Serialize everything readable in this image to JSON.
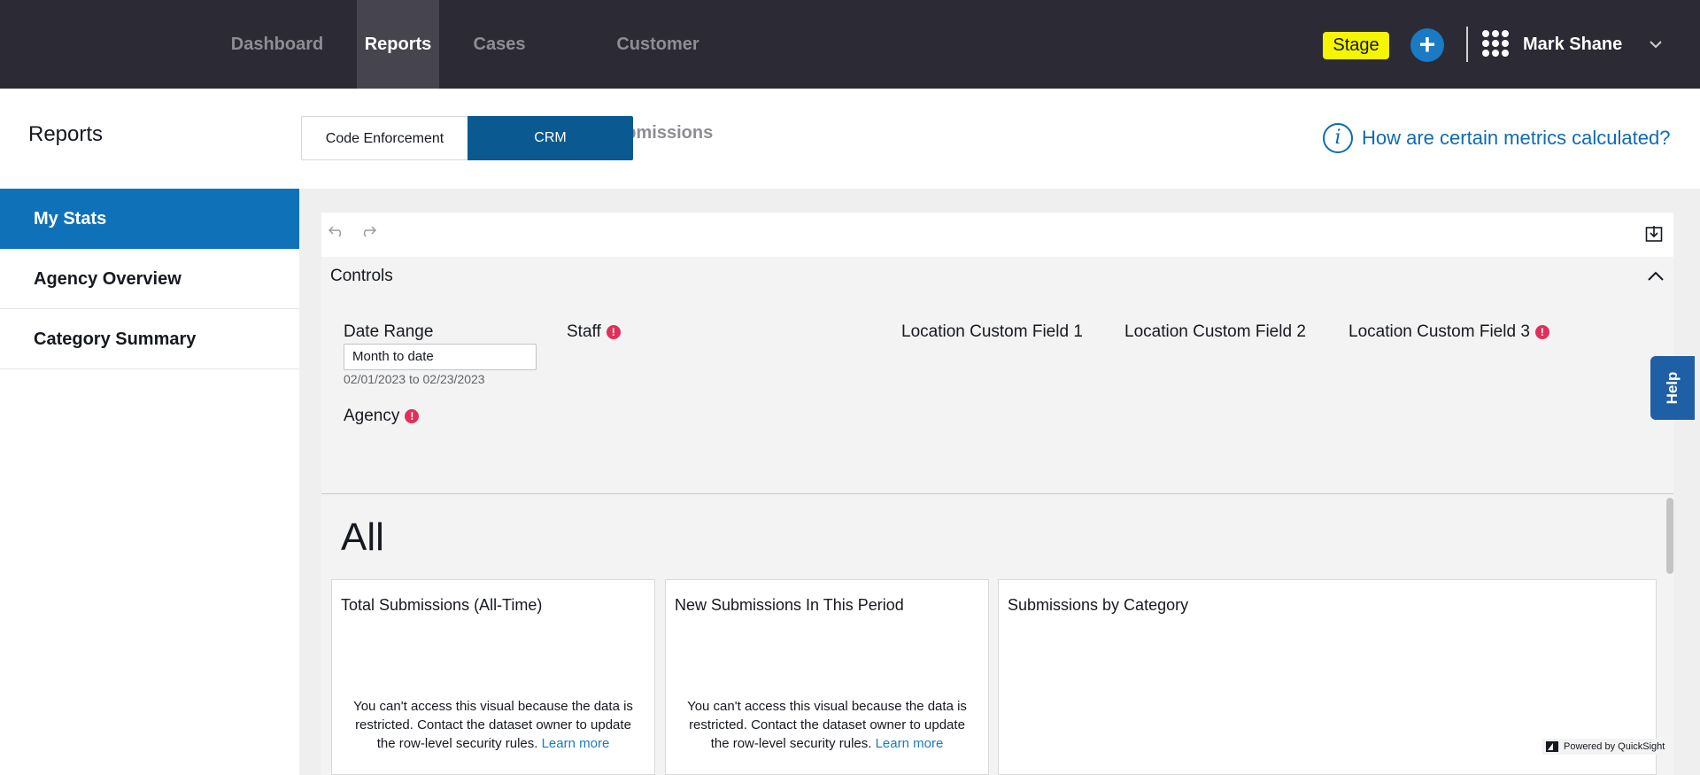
{
  "nav": {
    "tabs": [
      {
        "label": "Dashboard",
        "active": false
      },
      {
        "label": "Reports",
        "active": true
      },
      {
        "label": "Cases",
        "active": false
      },
      {
        "label": "Customer Submissions",
        "active": false
      }
    ],
    "stage_badge": "Stage",
    "plus_icon": "plus-icon",
    "apps_icon": "apps-grid-icon",
    "user_name": "Mark Shane",
    "user_menu_icon": "chevron-down-icon"
  },
  "header": {
    "title": "Reports",
    "segments": [
      {
        "label": "Code Enforcement",
        "active": false
      },
      {
        "label": "CRM",
        "active": true
      }
    ],
    "metrics_link": "How are certain metrics calculated?",
    "metrics_icon": "info-icon"
  },
  "sidebar": {
    "items": [
      {
        "label": "My Stats",
        "active": true
      },
      {
        "label": "Agency Overview",
        "active": false
      },
      {
        "label": "Category Summary",
        "active": false
      }
    ]
  },
  "toolbar": {
    "undo_icon": "undo-icon",
    "redo_icon": "redo-icon",
    "download_icon": "download-icon"
  },
  "controls": {
    "title": "Controls",
    "collapse_icon": "chevron-up-icon",
    "date_range": {
      "label": "Date Range",
      "value": "Month to date",
      "range_text": "02/01/2023 to 02/23/2023"
    },
    "staff": {
      "label": "Staff",
      "warning": "!"
    },
    "location_1": {
      "label": "Location Custom Field 1"
    },
    "location_2": {
      "label": "Location Custom Field 2"
    },
    "location_3": {
      "label": "Location Custom Field 3",
      "warning": "!"
    },
    "agency": {
      "label": "Agency",
      "warning": "!"
    }
  },
  "sheet": {
    "title": "All",
    "visuals": [
      {
        "title": "Total Submissions (All-Time)",
        "message": "You can't access this visual because the data is restricted. Contact the dataset owner to update the row-level security rules.",
        "link": "Learn more"
      },
      {
        "title": "New Submissions In This Period",
        "message": "You can't access this visual because the data is restricted. Contact the dataset owner to update the row-level security rules.",
        "link": "Learn more"
      },
      {
        "title": "Submissions by Category"
      }
    ],
    "powered_by": "Powered by QuickSight"
  },
  "help_tab": "Help",
  "colors": {
    "nav_bg": "#2b2a35",
    "accent_blue": "#0f72b9",
    "crm_blue": "#0a5a91",
    "stage_yellow": "#f5f500",
    "warning_red": "#e0305a"
  }
}
